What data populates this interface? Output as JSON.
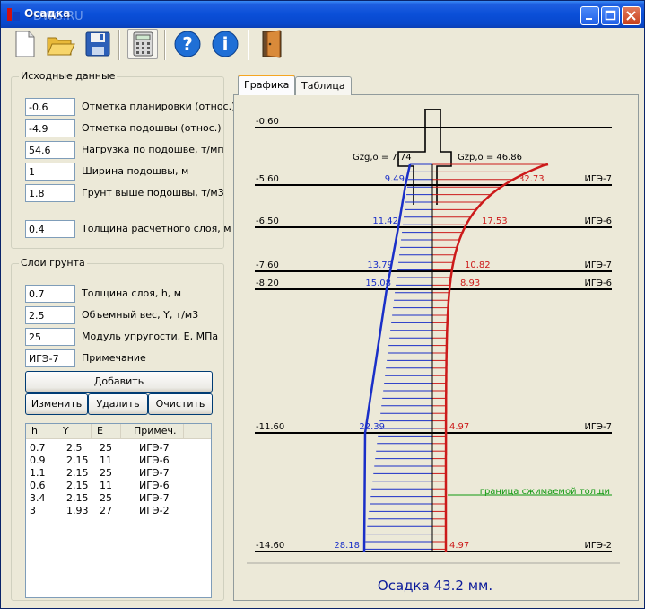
{
  "window": {
    "title": "Осадка",
    "watermark": "DWG.RU"
  },
  "toolbar": {
    "icons": [
      "new-file-icon",
      "open-folder-icon",
      "save-icon",
      "calculator-icon",
      "help-icon",
      "info-icon",
      "exit-door-icon"
    ],
    "help_glyph": "?",
    "info_glyph": "i"
  },
  "input_group": {
    "title": "Исходные данные",
    "fields": [
      {
        "value": "-0.6",
        "label": "Отметка планировки (относ.)"
      },
      {
        "value": "-4.9",
        "label": "Отметка подошвы (относ.)"
      },
      {
        "value": "54.6",
        "label": "Нагрузка по подошве, т/мп"
      },
      {
        "value": "1",
        "label": "Ширина подошвы, м"
      },
      {
        "value": "1.8",
        "label": "Грунт выше подошвы, т/м3"
      },
      {
        "value": "0.4",
        "label": "Толщина расчетного слоя, м"
      }
    ]
  },
  "layers_group": {
    "title": "Слои грунта",
    "fields": [
      {
        "value": "0.7",
        "label": "Толщина слоя, h, м"
      },
      {
        "value": "2.5",
        "label": "Объемный вес, Y, т/м3"
      },
      {
        "value": "25",
        "label": "Модуль упругости, Е, МПа"
      },
      {
        "value": "ИГЭ-7",
        "label": "Примечание"
      }
    ],
    "buttons": {
      "add": "Добавить",
      "edit": "Изменить",
      "delete": "Удалить",
      "clear": "Очистить"
    },
    "table": {
      "columns": [
        "h",
        "Y",
        "E",
        "Примеч."
      ],
      "rows": [
        [
          "0.7",
          "2.5",
          "25",
          "ИГЭ-7"
        ],
        [
          "0.9",
          "2.15",
          "11",
          "ИГЭ-6"
        ],
        [
          "1.1",
          "2.15",
          "25",
          "ИГЭ-7"
        ],
        [
          "0.6",
          "2.15",
          "11",
          "ИГЭ-6"
        ],
        [
          "3.4",
          "2.15",
          "25",
          "ИГЭ-7"
        ],
        [
          "3",
          "1.93",
          "27",
          "ИГЭ-2"
        ]
      ]
    }
  },
  "tabs": [
    "Графика",
    "Таблица"
  ],
  "colors": {
    "zg": "#1a2fc8",
    "zp": "#cc1a1a",
    "boundary": "#119911",
    "result": "#0a1a9a"
  },
  "diagram": {
    "levels": [
      {
        "mark": "-0.60",
        "zg": "",
        "zp": "",
        "ige": ""
      },
      {
        "mark": "-5.60",
        "zg": "9.49",
        "zp": "32.73",
        "ige": "ИГЭ-7"
      },
      {
        "mark": "-6.50",
        "zg": "11.42",
        "zp": "17.53",
        "ige": "ИГЭ-6"
      },
      {
        "mark": "-7.60",
        "zg": "13.79",
        "zp": "10.82",
        "ige": "ИГЭ-7"
      },
      {
        "mark": "-8.20",
        "zg": "15.08",
        "zp": "8.93",
        "ige": "ИГЭ-6"
      },
      {
        "mark": "-11.60",
        "zg": "22.39",
        "zp": "4.97",
        "ige": "ИГЭ-7"
      },
      {
        "mark": "-14.60",
        "zg": "28.18",
        "zp": "4.97",
        "ige": "ИГЭ-2"
      }
    ],
    "zg0_label": "Gzg,o = 7.74",
    "zp0_label": "Gzp,o = 46.86",
    "boundary_label": "граница сжимаемой толщи",
    "result": "Осадка 43.2 мм."
  }
}
